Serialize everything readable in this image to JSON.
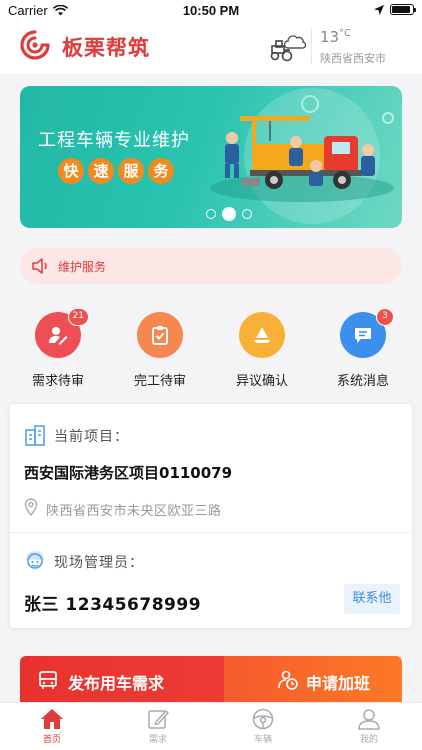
{
  "status_bar": {
    "carrier": "Carrier",
    "time": "10:50 PM",
    "battery_level": 0.9
  },
  "header": {
    "brand": "板栗帮筑",
    "weather": {
      "temperature": "13",
      "unit": "°C",
      "city": "陕西省西安市",
      "icon": "tractor-cloud-icon"
    }
  },
  "banner": {
    "title": "工程车辆专业维护",
    "chips": [
      "快",
      "速",
      "服",
      "务"
    ],
    "slide_count": 3,
    "active_slide": 2
  },
  "notice": {
    "text": "维护服务",
    "icon": "speaker-icon"
  },
  "quick_actions": [
    {
      "label": "需求待审",
      "badge": "21",
      "color": "#ee4f55",
      "icon": "user-edit-icon"
    },
    {
      "label": "完工待审",
      "badge": "",
      "color": "#f5874f",
      "icon": "clipboard-check-icon"
    },
    {
      "label": "异议确认",
      "badge": "",
      "color": "#f8b136",
      "icon": "sailboat-icon"
    },
    {
      "label": "系统消息",
      "badge": "3",
      "color": "#3d8fee",
      "icon": "message-icon"
    }
  ],
  "project": {
    "current_label": "当前项目：",
    "name": "西安国际港务区项目0110079",
    "address": "陕西省西安市未央区欧亚三路",
    "manager_label": "现场管理员：",
    "manager": "张三  12345678999",
    "contact_button": "联系他"
  },
  "actions": {
    "publish": "发布用车需求",
    "overtime": "申请加班"
  },
  "tabbar": [
    {
      "label": "首页",
      "icon": "home-icon",
      "active": true
    },
    {
      "label": "需求",
      "icon": "edit-icon",
      "active": false
    },
    {
      "label": "车辆",
      "icon": "steering-wheel-icon",
      "active": false
    },
    {
      "label": "我的",
      "icon": "user-icon",
      "active": false
    }
  ],
  "colors": {
    "brand_red": "#e03a3a",
    "banner_teal": "#29c3b0",
    "link_blue": "#3b8ee3"
  }
}
